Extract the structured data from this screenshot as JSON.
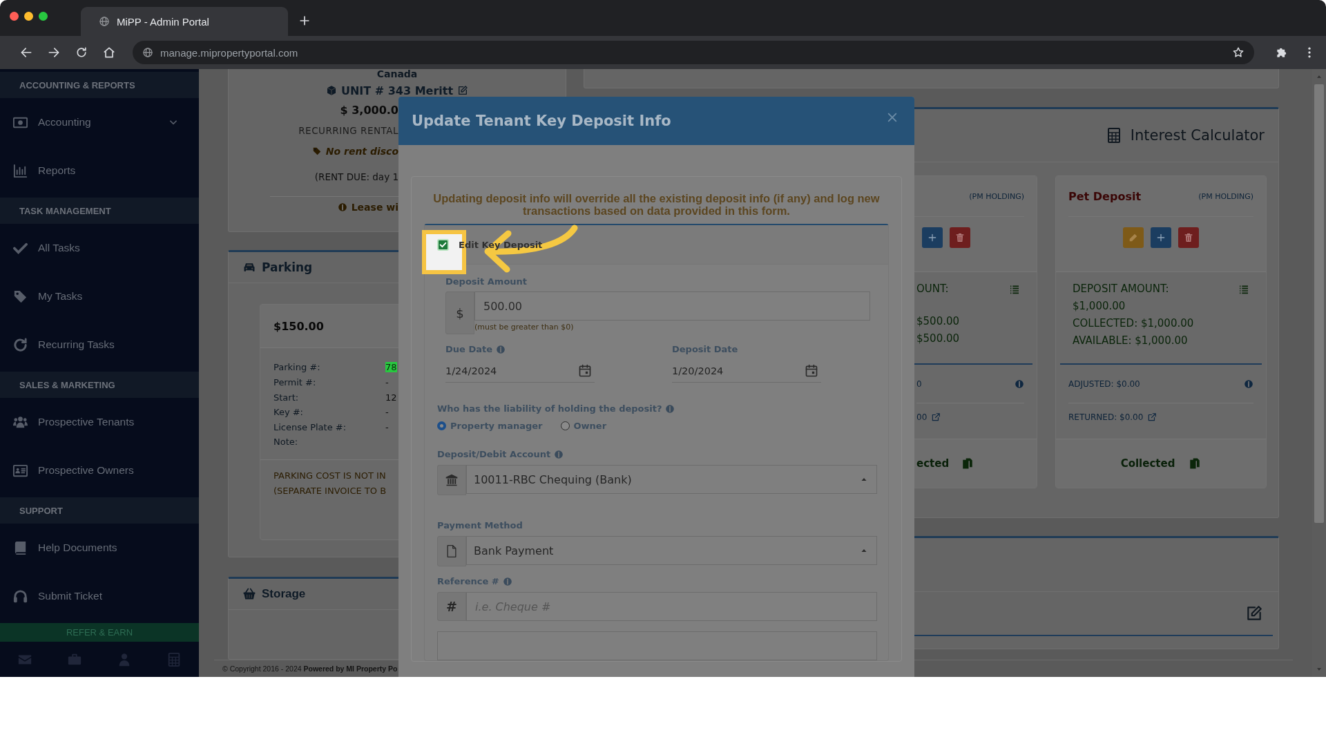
{
  "browser": {
    "tab_title": "MiPP - Admin Portal",
    "url": "manage.mipropertyportal.com"
  },
  "sidebar": {
    "sections": [
      {
        "title": "ACCOUNTING & REPORTS",
        "items": [
          {
            "label": "Accounting",
            "expandable": true
          },
          {
            "label": "Reports",
            "expandable": false
          }
        ]
      },
      {
        "title": "TASK MANAGEMENT",
        "items": [
          {
            "label": "All Tasks",
            "expandable": false
          },
          {
            "label": "My Tasks",
            "expandable": false
          },
          {
            "label": "Recurring Tasks",
            "expandable": false
          }
        ]
      },
      {
        "title": "SALES & MARKETING",
        "items": [
          {
            "label": "Prospective Tenants",
            "expandable": false
          },
          {
            "label": "Prospective Owners",
            "expandable": false
          }
        ]
      },
      {
        "title": "SUPPORT",
        "items": [
          {
            "label": "Help Documents",
            "expandable": false
          },
          {
            "label": "Submit Ticket",
            "expandable": false
          }
        ]
      }
    ],
    "refer_button": "REFER & EARN"
  },
  "lease_card": {
    "location": "Canada",
    "unit": "UNIT # 343 Meritt",
    "rent": "$ 3,000.0",
    "recurring": "RECURRING RENTAL",
    "discount": "No rent disco",
    "rent_due": "(RENT DUE: day 1",
    "lease_note": "Lease wi"
  },
  "parking": {
    "title": "Parking",
    "price": "$150.00",
    "rows": [
      {
        "label": "Parking #:",
        "value": "78"
      },
      {
        "label": "Permit #:",
        "value": "-"
      },
      {
        "label": "Start:",
        "value": "12"
      },
      {
        "label": "Key #:",
        "value": "-"
      },
      {
        "label": "License Plate #:",
        "value": "-"
      },
      {
        "label": "Note:"
      }
    ],
    "notice": [
      "PARKING COST IS NOT IN",
      "(SEPARATE INVOICE TO B"
    ]
  },
  "storage": {
    "title": "Storage"
  },
  "footer": "© Copyright 2016 - 2024 **Powered by MI Property Po**",
  "deposits": {
    "title": "Interest Calculator",
    "cards": [
      {
        "kind": "partial",
        "holding": "(PM HOLDING)",
        "buttons": [
          {
            "kind": "add"
          },
          {
            "kind": "delete"
          }
        ],
        "amount_label": "OUNT:",
        "lines": [
          "$500.00",
          "$500.00"
        ],
        "adjusted": "0",
        "returned": "00",
        "status": "ected"
      },
      {
        "kind": "full",
        "title": "Pet Deposit",
        "holding": "(PM HOLDING)",
        "buttons": [
          {
            "kind": "edit"
          },
          {
            "kind": "add"
          },
          {
            "kind": "delete"
          }
        ],
        "amount_label": "DEPOSIT AMOUNT:",
        "lines": [
          "$1,000.00",
          "COLLECTED: $1,000.00",
          "AVAILABLE: $1,000.00"
        ],
        "adjusted": "ADJUSTED: $0.00",
        "returned": "RETURNED: $0.00",
        "status": "Collected"
      }
    ]
  },
  "modal": {
    "title": "Update Tenant Key Deposit Info",
    "warning": "Updating deposit info will override all the existing deposit info (if any) and log new transactions based on data provided in this form.",
    "edit_toggle": {
      "label": "Edit Key Deposit",
      "checked": true
    },
    "deposit_amount": {
      "label": "Deposit Amount",
      "prefix": "$",
      "value": "500.00",
      "hint": "(must be greater than $0)"
    },
    "dates": [
      {
        "label": "Due Date",
        "info": true,
        "value": "1/24/2024"
      },
      {
        "label": "Deposit Date",
        "info": false,
        "value": "1/20/2024"
      }
    ],
    "liability": {
      "question": "Who has the liability of holding the deposit?",
      "options": [
        {
          "label": "Property manager",
          "selected": true
        },
        {
          "label": "Owner",
          "selected": false
        }
      ]
    },
    "account": {
      "label": "Deposit/Debit Account",
      "value": "10011-RBC Chequing (Bank)"
    },
    "payment_method": {
      "label": "Payment Method",
      "value": "Bank Payment"
    },
    "reference": {
      "label": "Reference #",
      "prefix": "#",
      "placeholder": "i.e. Cheque #"
    }
  }
}
